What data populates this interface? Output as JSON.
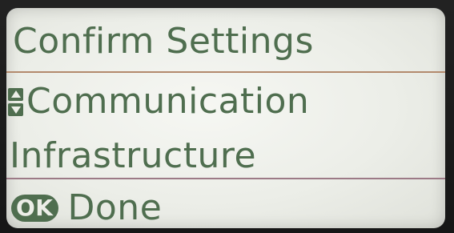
{
  "screen": {
    "title": "Confirm Settings",
    "setting_label": "Communication",
    "setting_value": "Infrastructure",
    "ok_button_label": "OK",
    "done_label": "Done"
  },
  "icons": {
    "scroll": "up-down-arrows-icon"
  },
  "colors": {
    "text": "#4f6e4f",
    "background": "#eceee8",
    "divider_top": "#b38a6d",
    "divider_bottom": "#9c7a86"
  }
}
